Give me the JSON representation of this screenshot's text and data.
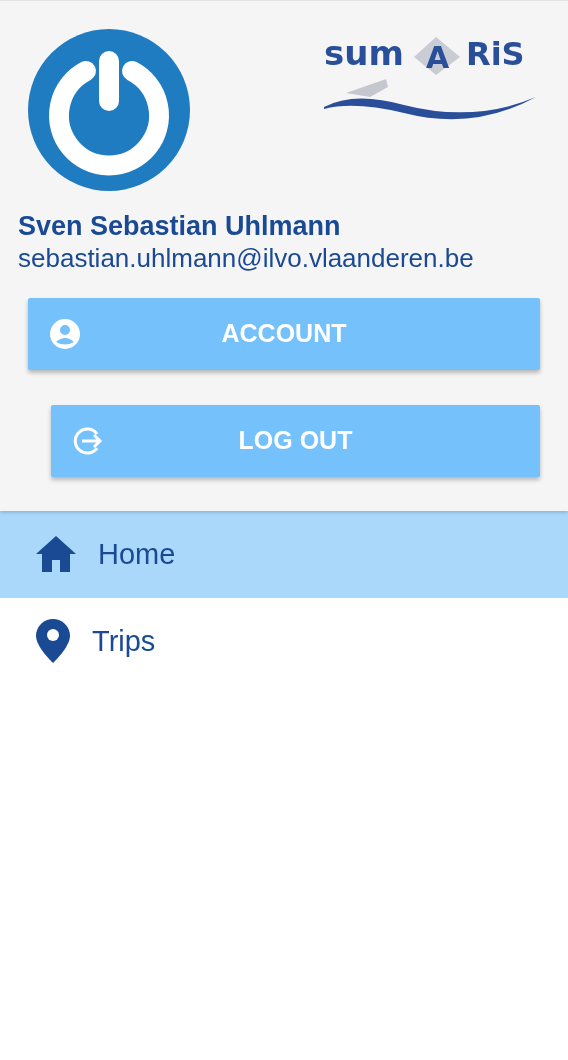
{
  "logo": {
    "before": "sum",
    "badge": "A",
    "after": "RiS"
  },
  "user": {
    "name": "Sven Sebastian Uhlmann",
    "email": "sebastian.uhlmann@ilvo.vlaanderen.be"
  },
  "buttons": [
    {
      "label": "ACCOUNT",
      "kind": "account"
    },
    {
      "label": "LOG OUT",
      "kind": "logout"
    }
  ],
  "menu": [
    {
      "label": "Home",
      "kind": "home",
      "selected": true
    },
    {
      "label": "Trips",
      "kind": "trips",
      "selected": false
    }
  ]
}
